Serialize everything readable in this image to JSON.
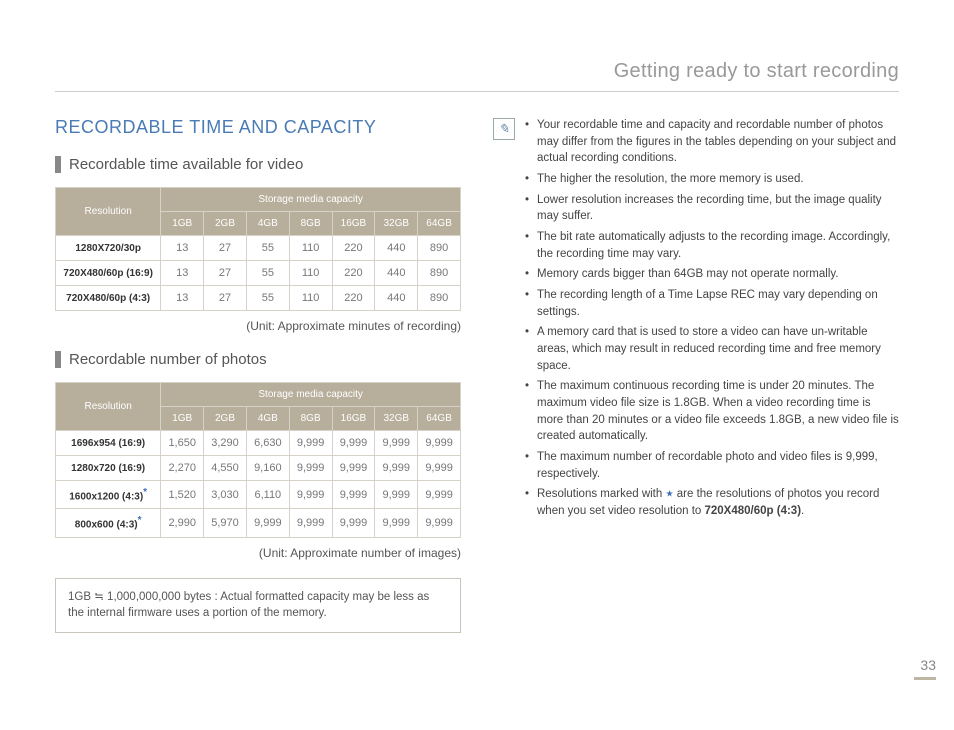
{
  "header": {
    "title": "Getting ready to start recording"
  },
  "main_title": "RECORDABLE TIME AND CAPACITY",
  "video_section": {
    "heading": "Recordable time available for video",
    "resolution_header": "Resolution",
    "capacity_header": "Storage media capacity",
    "columns": [
      "1GB",
      "2GB",
      "4GB",
      "8GB",
      "16GB",
      "32GB",
      "64GB"
    ],
    "rows": [
      {
        "label": "1280X720/30p",
        "vals": [
          "13",
          "27",
          "55",
          "110",
          "220",
          "440",
          "890"
        ]
      },
      {
        "label": "720X480/60p (16:9)",
        "vals": [
          "13",
          "27",
          "55",
          "110",
          "220",
          "440",
          "890"
        ]
      },
      {
        "label": "720X480/60p (4:3)",
        "vals": [
          "13",
          "27",
          "55",
          "110",
          "220",
          "440",
          "890"
        ]
      }
    ],
    "unit": "(Unit: Approximate minutes of recording)"
  },
  "photo_section": {
    "heading": "Recordable number of photos",
    "resolution_header": "Resolution",
    "capacity_header": "Storage media capacity",
    "columns": [
      "1GB",
      "2GB",
      "4GB",
      "8GB",
      "16GB",
      "32GB",
      "64GB"
    ],
    "rows": [
      {
        "label": "1696x954 (16:9)",
        "star": false,
        "vals": [
          "1,650",
          "3,290",
          "6,630",
          "9,999",
          "9,999",
          "9,999",
          "9,999"
        ]
      },
      {
        "label": "1280x720 (16:9)",
        "star": false,
        "vals": [
          "2,270",
          "4,550",
          "9,160",
          "9,999",
          "9,999",
          "9,999",
          "9,999"
        ]
      },
      {
        "label": "1600x1200 (4:3)",
        "star": true,
        "vals": [
          "1,520",
          "3,030",
          "6,110",
          "9,999",
          "9,999",
          "9,999",
          "9,999"
        ]
      },
      {
        "label": "800x600 (4:3)",
        "star": true,
        "vals": [
          "2,990",
          "5,970",
          "9,999",
          "9,999",
          "9,999",
          "9,999",
          "9,999"
        ]
      }
    ],
    "unit": "(Unit: Approximate number of images)"
  },
  "note_box": "1GB ≒ 1,000,000,000 bytes : Actual formatted capacity may be less as the internal firmware uses a portion of the memory.",
  "notes": [
    "Your recordable time and capacity and recordable number of photos may differ from the figures in the tables depending on your subject and actual recording conditions.",
    "The higher the resolution, the more memory is used.",
    "Lower resolution increases the recording time, but the image quality may suffer.",
    "The bit rate automatically adjusts to the recording image. Accordingly, the recording time may vary.",
    "Memory cards bigger than 64GB may not operate normally.",
    "The recording length of a Time Lapse REC may vary depending on settings.",
    "A memory card that is used to store a video can have un-writable areas, which may result in reduced recording time and free memory space.",
    "The maximum continuous recording time is under 20 minutes. The maximum video file size is 1.8GB. When a video recording time is more than 20 minutes or a video file exceeds 1.8GB, a new video file is created automatically.",
    "The maximum number of recordable photo and video files is 9,999, respectively."
  ],
  "note_star": {
    "prefix": "Resolutions marked with ",
    "suffix": " are the resolutions of photos you record when you set video resolution to ",
    "bold": "720X480/60p (4:3)",
    "end": "."
  },
  "page_number": "33"
}
